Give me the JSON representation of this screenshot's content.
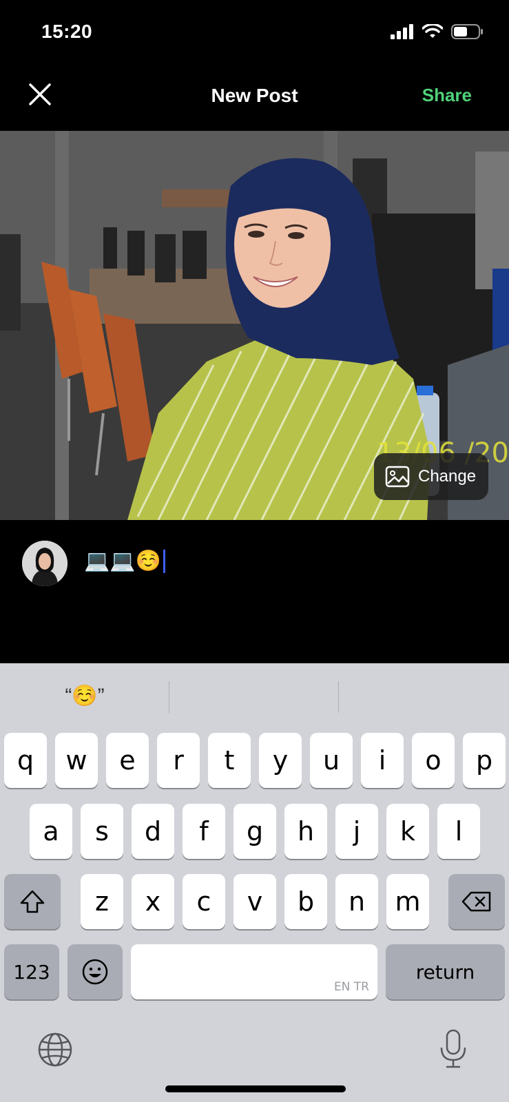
{
  "status_bar": {
    "time": "15:20"
  },
  "nav": {
    "title": "New Post",
    "share_label": "Share"
  },
  "photo": {
    "change_label": "Change",
    "date_stamp": "13/06 /20"
  },
  "compose": {
    "caption_text": "💻💻☺️"
  },
  "keyboard": {
    "suggestion": "“☺️”",
    "row1": [
      "q",
      "w",
      "e",
      "r",
      "t",
      "y",
      "u",
      "i",
      "o",
      "p"
    ],
    "row2": [
      "a",
      "s",
      "d",
      "f",
      "g",
      "h",
      "j",
      "k",
      "l"
    ],
    "row3": [
      "z",
      "x",
      "c",
      "v",
      "b",
      "n",
      "m"
    ],
    "numbers_label": "123",
    "space_lang": "EN TR",
    "return_label": "return"
  },
  "colors": {
    "accent_share": "#4fd17a",
    "keyboard_bg": "#d1d3d9",
    "cursor": "#4060ff"
  }
}
